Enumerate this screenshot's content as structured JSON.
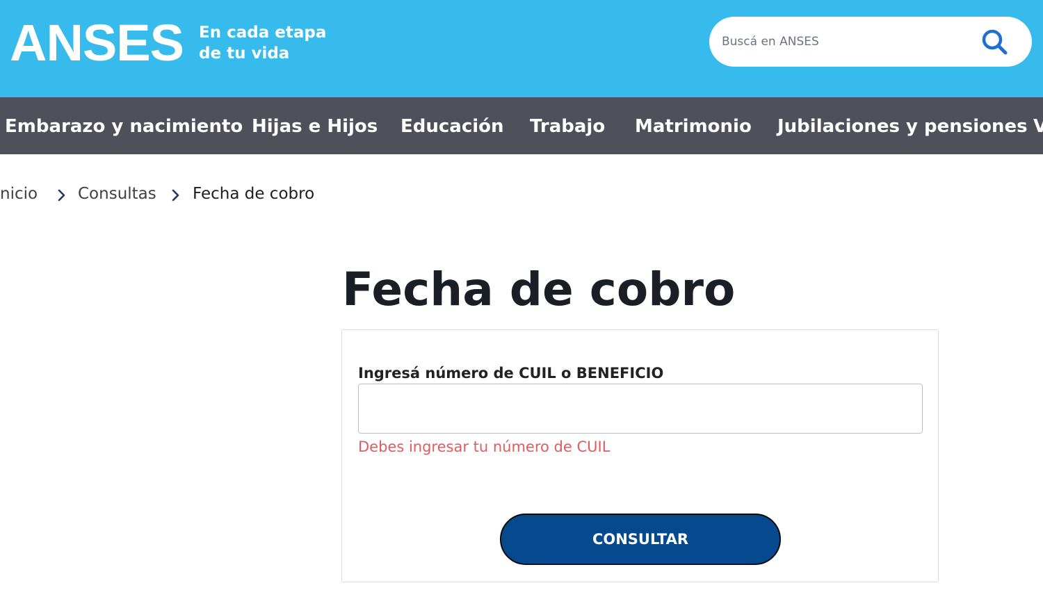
{
  "header": {
    "logo_text": "ANSES",
    "tagline_line1": "En cada etapa",
    "tagline_line2": "de tu vida",
    "search_placeholder": "Buscá en ANSES",
    "search_icon": "search-icon",
    "background_color": "#37bbed"
  },
  "nav": {
    "background_color": "#4e5159",
    "items": [
      {
        "label": "Embarazo y nacimiento"
      },
      {
        "label": "Hijas e Hijos"
      },
      {
        "label": "Educación"
      },
      {
        "label": "Trabajo"
      },
      {
        "label": "Matrimonio"
      },
      {
        "label": "Jubilaciones y pensiones"
      },
      {
        "label": "V"
      }
    ]
  },
  "breadcrumb": {
    "items": [
      "nicio",
      "Consultas",
      "Fecha de cobro"
    ],
    "separator_icon": "chevron-right-icon"
  },
  "main": {
    "title": "Fecha de cobro",
    "form": {
      "label": "Ingresá número de CUIL o BENEFICIO",
      "input_value": "",
      "error_message": "Debes ingresar tu número de CUIL",
      "error_color": "#e35b5b",
      "submit_label": "CONSULTAR",
      "submit_color": "#07498f"
    }
  }
}
